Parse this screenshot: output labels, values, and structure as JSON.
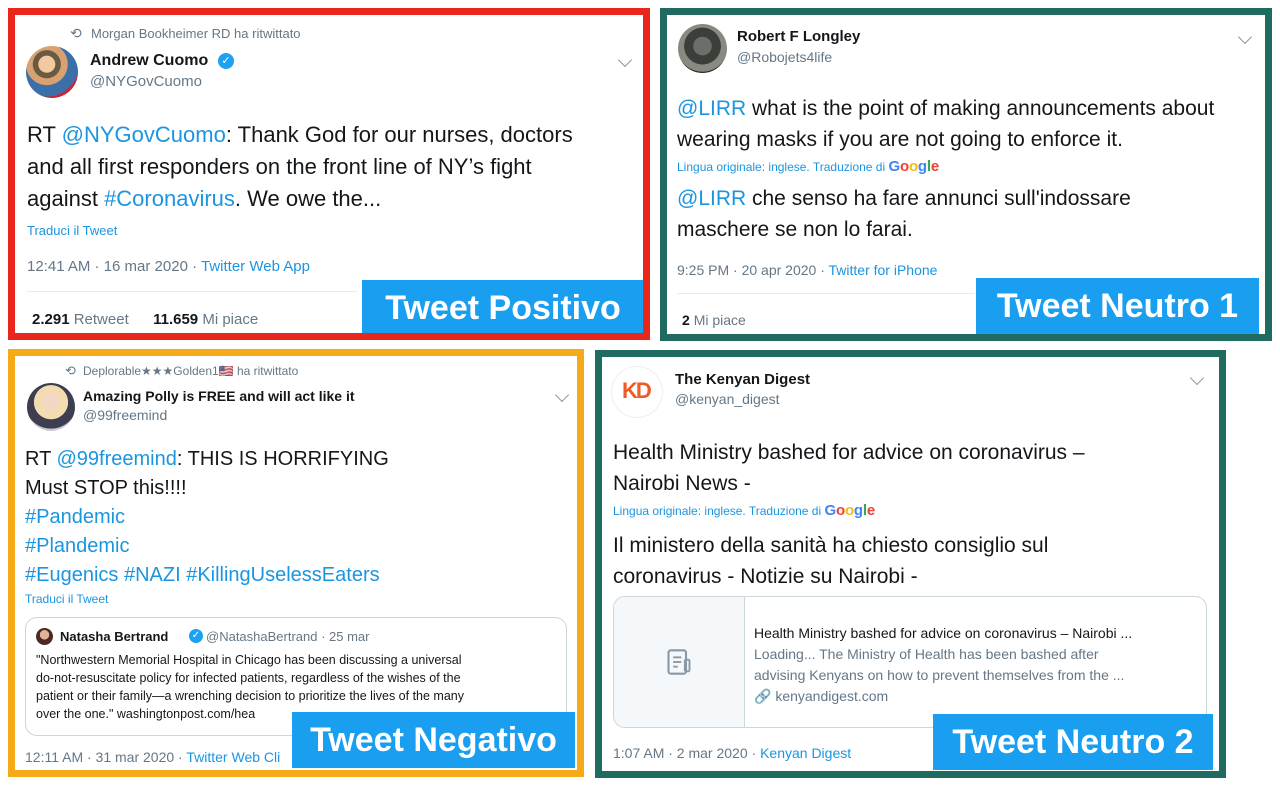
{
  "colors": {
    "positive_border": "#e8261c",
    "neutral_border": "#1f6b5f",
    "negative_border": "#f5ab17",
    "label_bg": "#1a9ef0",
    "link": "#1b95e0"
  },
  "positive": {
    "retweeted_by": "Morgan Bookheimer RD ha ritwittato",
    "name": "Andrew Cuomo",
    "handle": "@NYGovCuomo",
    "text_rt": "RT ",
    "text_mention": "@NYGovCuomo",
    "text_part1": ": Thank God for our nurses, doctors",
    "text_line2": "and all first responders on the front line of NY’s fight",
    "text_line3_a": "against ",
    "text_hashtag": "#Coronavirus",
    "text_line3_b": ". We owe the...",
    "translate": "Traduci il Tweet",
    "timestamp": "12:41 AM · 16 mar 2020 · ",
    "source": "Twitter Web App",
    "retweets_count": "2.291",
    "retweets_label": "Retweet",
    "likes_count": "11.659",
    "likes_label": "Mi piace",
    "label": "Tweet Positivo"
  },
  "neutral1": {
    "name": "Robert F Longley",
    "handle": "@Robojets4life",
    "mention": "@LIRR",
    "text_line1": " what is the point of making announcements about",
    "text_line2": "wearing masks if you are not going to enforce it.",
    "orig_lang": "Lingua originale: inglese. Traduzione di",
    "trans_mention": "@LIRR",
    "trans_line1": " che senso ha fare annunci sull'indossare",
    "trans_line2": "maschere se non lo farai.",
    "timestamp": "9:25 PM · 20 apr 2020 · ",
    "source": "Twitter for iPhone",
    "likes_count": "2",
    "likes_label": "Mi piace",
    "label": "Tweet Neutro 1"
  },
  "negative": {
    "retweeted_by": "Deplorable★★★Golden1🇺🇸 ha ritwittato",
    "name": "Amazing Polly is FREE and will act like it",
    "handle": "@99freemind",
    "text_rt": "RT ",
    "text_mention": "@99freemind",
    "text_part1": ": THIS IS HORRIFYING",
    "text_line2": "Must STOP this!!!!",
    "hashtag1": "#Pandemic",
    "hashtag2": "#Plandemic",
    "hashtag3": "#Eugenics #NAZI #KillingUselessEaters",
    "translate": "Traduci il Tweet",
    "quote_name": "Natasha Bertrand",
    "quote_meta": "@NatashaBertrand · 25 mar",
    "quote_line1": "\"Northwestern Memorial Hospital in Chicago has been discussing a universal",
    "quote_line2": "do-not-resuscitate policy for infected patients, regardless of the wishes of the",
    "quote_line3": "patient or their family—a wrenching decision to prioritize the lives of the many",
    "quote_line4": "over the one.\" washingtonpost.com/hea",
    "timestamp": "12:11 AM · 31 mar 2020 · ",
    "source": "Twitter Web Cli",
    "label": "Tweet Negativo"
  },
  "neutral2": {
    "logo_text": "KD",
    "name": "The Kenyan Digest",
    "handle": "@kenyan_digest",
    "text_line1": "Health Ministry bashed for advice on coronavirus –",
    "text_line2": "Nairobi News -",
    "orig_lang": "Lingua originale: inglese. Traduzione di",
    "trans_line1": "Il ministero della sanità ha chiesto consiglio sul",
    "trans_line2": "coronavirus - Notizie su Nairobi -",
    "card_title": "Health Ministry bashed for advice on coronavirus – Nairobi ...",
    "card_desc1": "Loading... The Ministry of Health has been bashed after",
    "card_desc2": "advising Kenyans on how to prevent themselves from the ...",
    "card_domain": "kenyandigest.com",
    "timestamp": "1:07 AM · 2 mar 2020 · ",
    "source": "Kenyan Digest",
    "label": "Tweet Neutro 2"
  },
  "google": {
    "g1": "G",
    "o1": "o",
    "o2": "o",
    "g2": "g",
    "l": "l",
    "e": "e"
  },
  "icons": [
    "retweet-icon",
    "verified-badge-icon",
    "chevron-down-icon",
    "document-icon",
    "link-icon",
    "star-icon",
    "us-flag-icon"
  ]
}
